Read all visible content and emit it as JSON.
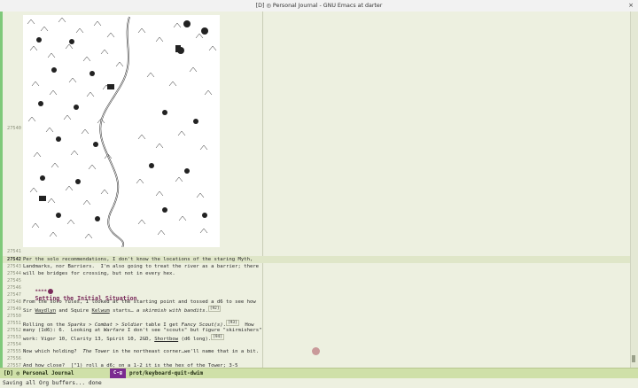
{
  "window": {
    "title": "[D] ◎ Personal Journal - GNU Emacs at darter",
    "close_symbol": "×"
  },
  "buffer": {
    "image_line": "27540",
    "lines": [
      {
        "num": "27541",
        "text": ""
      },
      {
        "num": "27542",
        "text": "Per the solo recommendations, I don't know the locations of the staring Myth,"
      },
      {
        "num": "27543",
        "text": "Landmarks, nor Barriers.  I'm also going to treat the river as a barrier; there"
      },
      {
        "num": "27544",
        "text": "will be bridges for crossing, but not in every hex."
      },
      {
        "num": "27545",
        "text": ""
      },
      {
        "num": "27546",
        "heading_stars": "****",
        "heading_text": "Setting the Initial Situation"
      },
      {
        "num": "27547",
        "text": ""
      },
      {
        "num": "27548",
        "text": "From the solo rules, I looked at the starting point and tossed a d6 to see how"
      },
      {
        "num": "27549",
        "p1": "Sir ",
        "u1": "Waydlyn",
        "p2": " and Squire ",
        "u2": "Kelwum",
        "p3": " starts… ",
        "i1": "a skirmish with bandits",
        "p4": ".",
        "fn": "[92]"
      },
      {
        "num": "27550",
        "text": ""
      },
      {
        "num": "27551",
        "p1": "Rolling on the ",
        "i1": "Sparks > Combat > Soldier",
        "p2": " table I get ",
        "i2": "Fancy Scout(s)",
        "p3": ".",
        "fn": "[93]",
        "p4": "  How"
      },
      {
        "num": "27552",
        "p1": "many (1d6): 6.  Looking at ",
        "i1": "Warfare",
        "p2": " I don't see \"scouts\" but figure \"skirmishers\""
      },
      {
        "num": "27553",
        "p1": "work: Vigor 10, Clarity 13, Spirit 10, 2GD, ",
        "u1": "Shortbow",
        "p2": " (d6 long).",
        "fn": "[94]"
      },
      {
        "num": "27554",
        "text": ""
      },
      {
        "num": "27555",
        "p1": "Now which holding?  ",
        "i1": "The Tower",
        "p2": " in the northeast corner…we'll name that in a bit."
      },
      {
        "num": "27556",
        "text": ""
      },
      {
        "num": "27557",
        "text": "And how close?  [\"1) roll a d6; on a 1-2 it is the hex of the Tower; 3-5"
      }
    ]
  },
  "modeline": {
    "left": "[D] ◎ Personal Journal",
    "key": "C-g",
    "command": "prot/keyboard-quit-dwim"
  },
  "echo_area": "Saving all Org buffers... done"
}
